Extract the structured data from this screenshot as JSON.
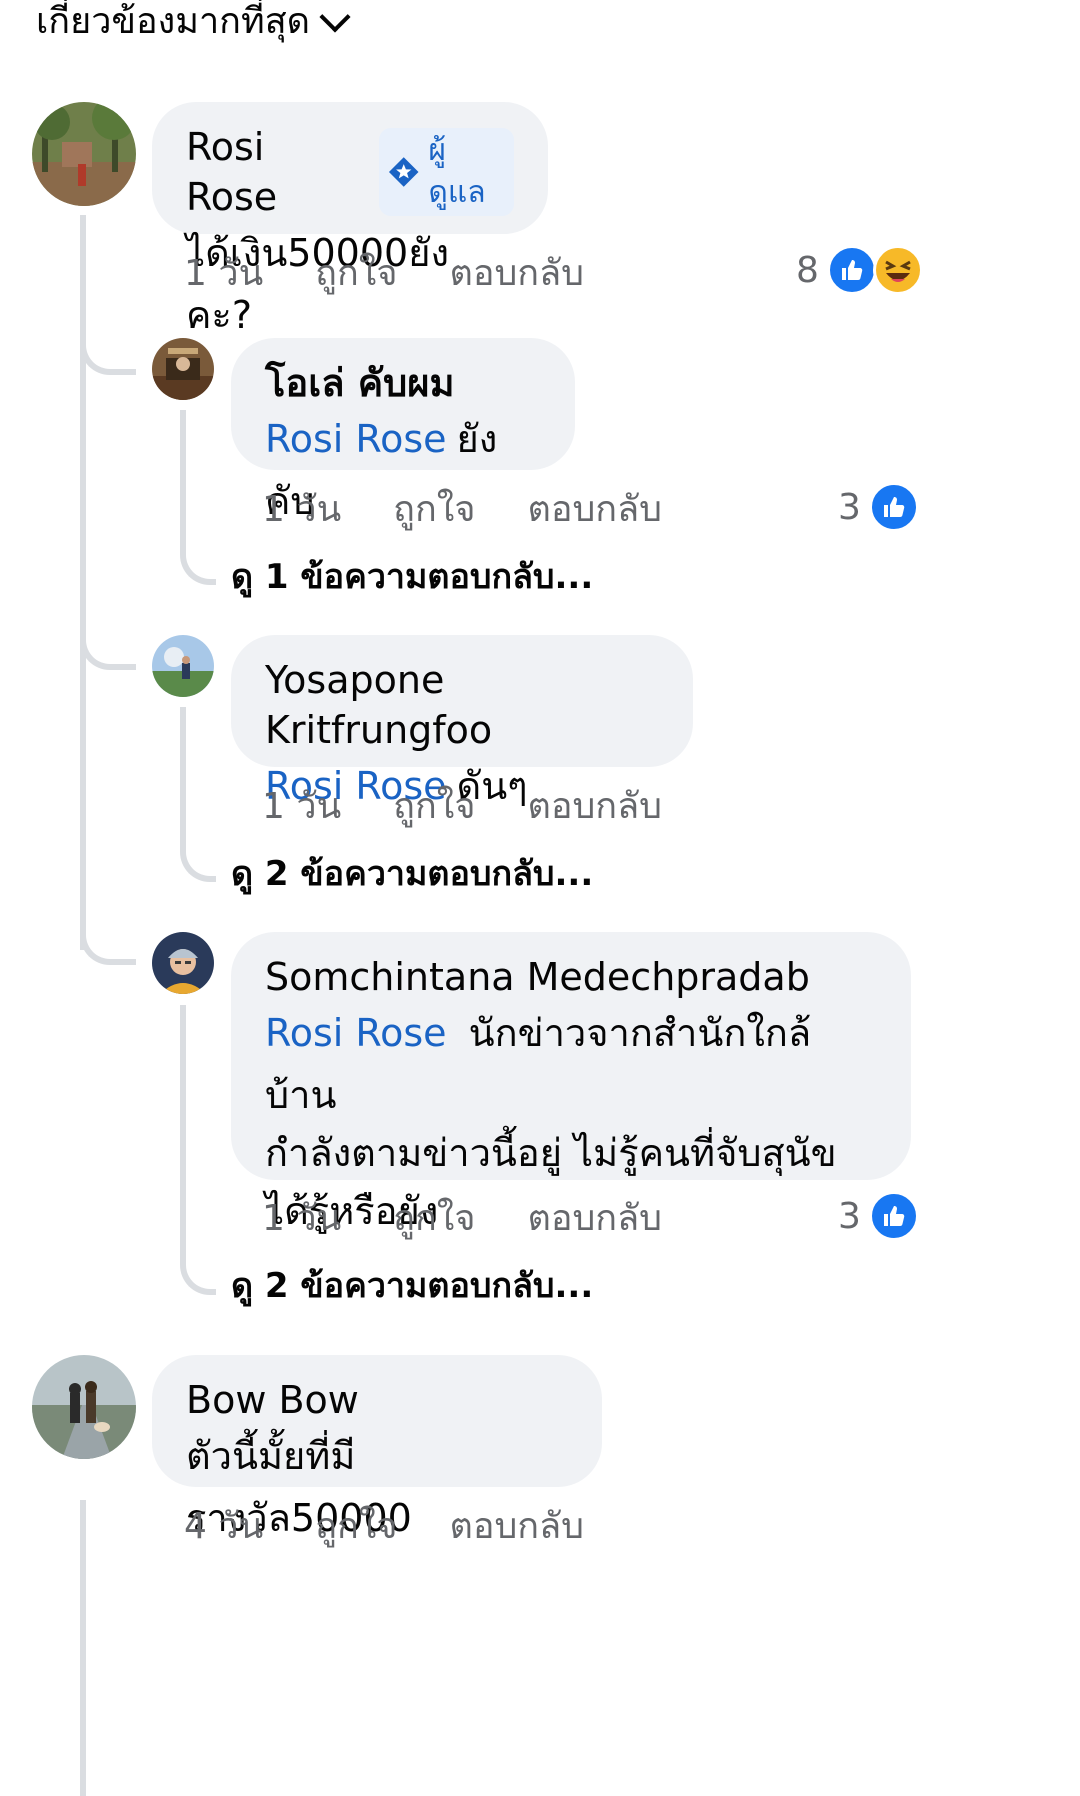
{
  "sort": {
    "label": "เกี่ยวข้องมากที่สุด"
  },
  "comments": [
    {
      "author": "Rosi Rose",
      "badge": "ผู้ดูแล",
      "text": "ได้เงิน50000ยังคะ?",
      "time": "1 วัน",
      "like_label": "ถูกใจ",
      "reply_label": "ตอบกลับ",
      "reaction_count": "8",
      "reactions": [
        "like-icon",
        "haha-icon"
      ],
      "replies": [
        {
          "author": "โอเล่ คับผม",
          "mention": "Rosi Rose",
          "text": "ยังคับ",
          "time": "1 วัน",
          "like_label": "ถูกใจ",
          "reply_label": "ตอบกลับ",
          "reaction_count": "3",
          "view_more": "ดู 1 ข้อความตอบกลับ..."
        },
        {
          "author": "Yosapone Kritfrungfoo",
          "mention": "Rosi Rose",
          "text": "ดันๆ",
          "time": "1 วัน",
          "like_label": "ถูกใจ",
          "reply_label": "ตอบกลับ",
          "view_more": "ดู 2 ข้อความตอบกลับ..."
        },
        {
          "author": "Somchintana Medechpradab",
          "mention": "Rosi Rose",
          "text_line1": "นักข่าวจากสำนักใกล้บ้าน",
          "text_line2": "กำลังตามข่าวนี้อยู่ ไม่รู้คนที่จับสุนัข",
          "text_line3": "ได้รู้หรือยัง",
          "time": "1 วัน",
          "like_label": "ถูกใจ",
          "reply_label": "ตอบกลับ",
          "reaction_count": "3",
          "view_more": "ดู 2 ข้อความตอบกลับ..."
        }
      ]
    },
    {
      "author": "Bow Bow",
      "text": "ตัวนี้มั้ยที่มีรางวัล50000",
      "time": "4 วัน",
      "like_label": "ถูกใจ",
      "reply_label": "ตอบกลับ"
    }
  ],
  "colors": {
    "mention": "#1a63c4",
    "bubble": "#f0f2f5",
    "like": "#1877f2",
    "haha": "#f7b928",
    "meta": "#65676b"
  }
}
